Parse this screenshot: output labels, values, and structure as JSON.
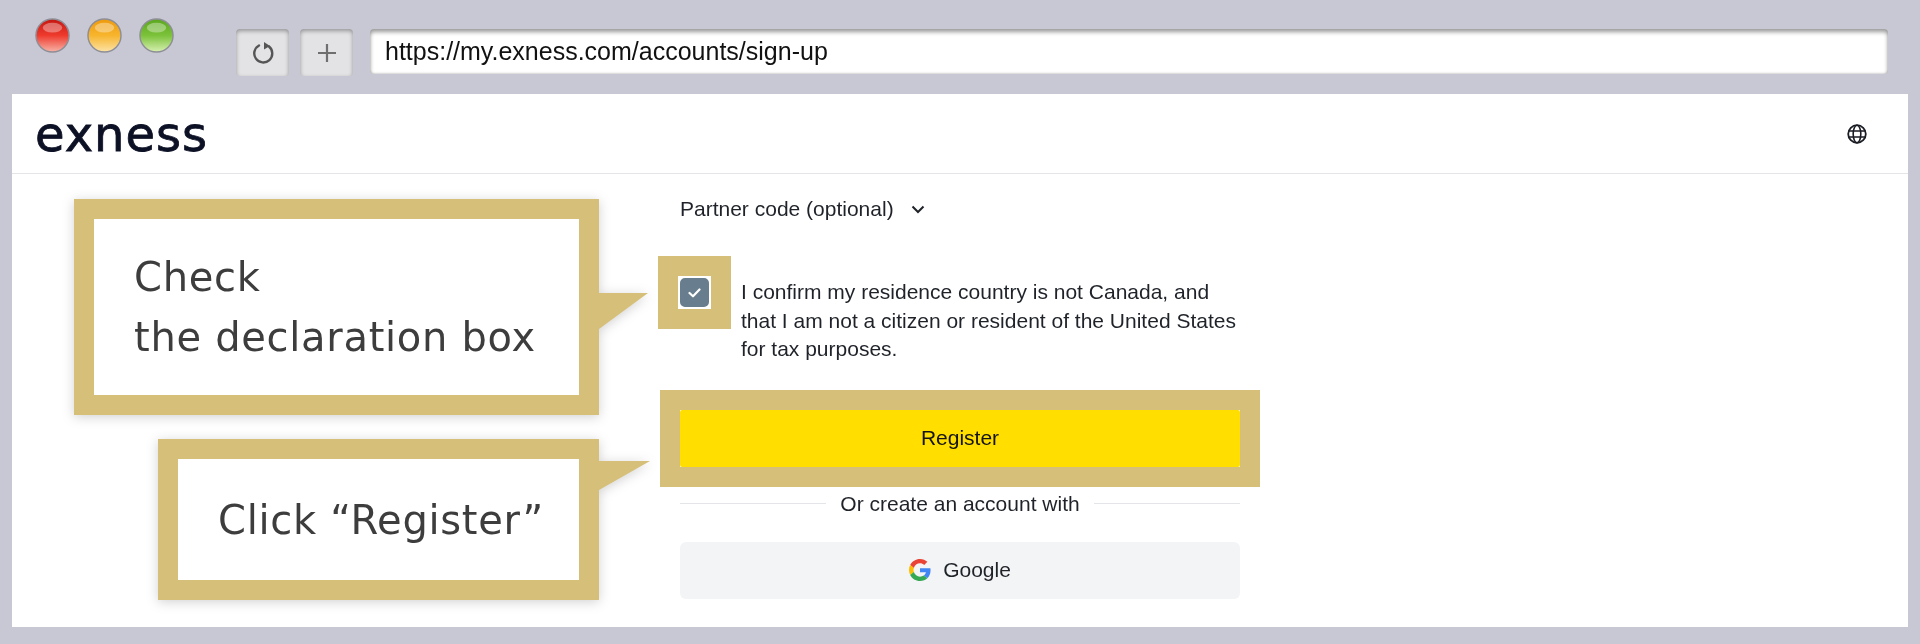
{
  "browser": {
    "url": "https://my.exness.com/accounts/sign-up"
  },
  "header": {
    "logo": "exness"
  },
  "form": {
    "partner_code": {
      "label": "Partner code (optional)",
      "expanded": false
    },
    "declaration": {
      "text": "I confirm my residence country is not Canada, and that I am not a citizen or resident of the United States for tax purposes.",
      "checked": true,
      "highlighted": true
    },
    "register_button": {
      "label": "Register",
      "highlighted": true
    },
    "divider": "Or create an account with",
    "google_button": {
      "label": "Google"
    }
  },
  "callouts": [
    {
      "lines": [
        "Check",
        "the declaration box"
      ]
    },
    {
      "lines": [
        "Click “Register”"
      ]
    }
  ]
}
